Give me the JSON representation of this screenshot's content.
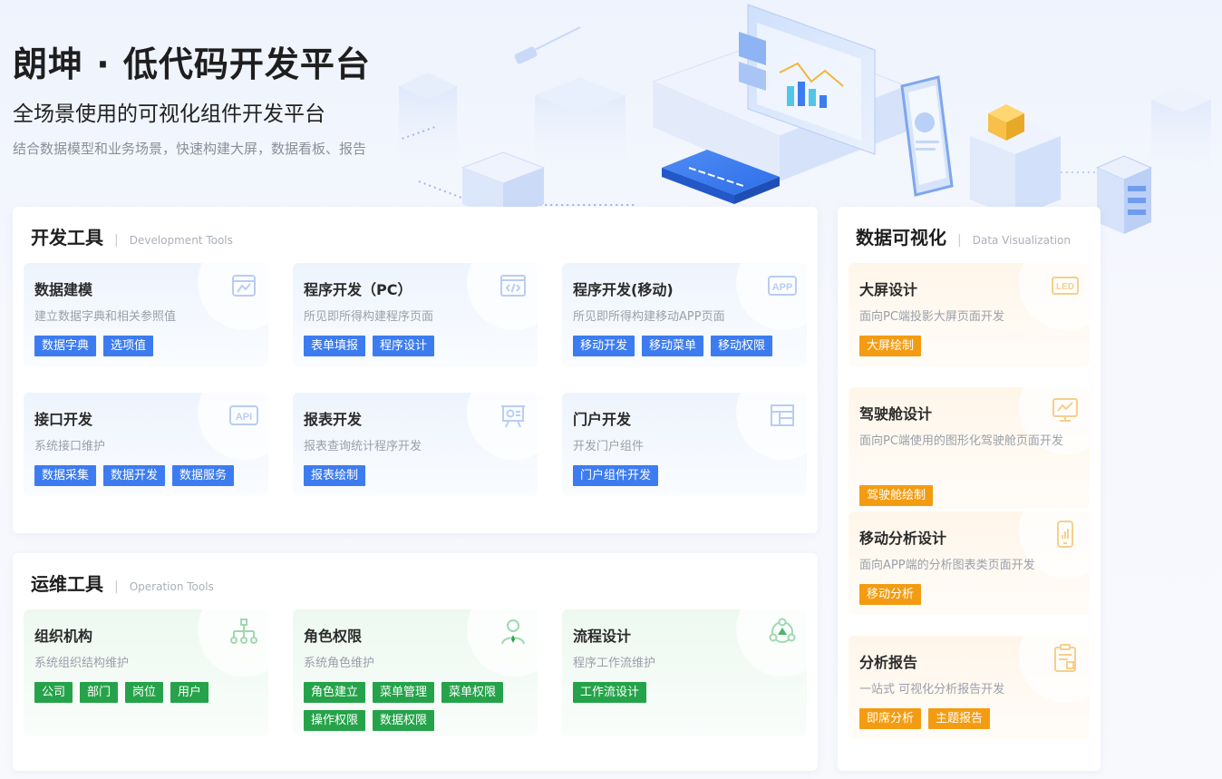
{
  "hero": {
    "title": "朗坤 · 低代码开发平台",
    "subtitle": "全场景使用的可视化组件开发平台",
    "description": "结合数据模型和业务场景，快速构建大屏，数据看板、报告"
  },
  "dev_tools": {
    "title": "开发工具",
    "title_en": "Development Tools",
    "cards": [
      {
        "title": "数据建模",
        "desc": "建立数据字典和相关参照值",
        "icon": "data-model-icon",
        "tags": [
          "数据字典",
          "选项值"
        ]
      },
      {
        "title": "程序开发（PC）",
        "desc": "所见即所得构建程序页面",
        "icon": "code-window-icon",
        "tags": [
          "表单填报",
          "程序设计"
        ]
      },
      {
        "title": "程序开发(移动)",
        "desc": "所见即所得构建移动APP页面",
        "icon": "app-icon",
        "icon_text": "APP",
        "tags": [
          "移动开发",
          "移动菜单",
          "移动权限"
        ]
      },
      {
        "title": "接口开发",
        "desc": "系统接口维护",
        "icon": "api-icon",
        "icon_text": "API",
        "tags": [
          "数据采集",
          "数据开发",
          "数据服务"
        ]
      },
      {
        "title": "报表开发",
        "desc": "报表查询统计程序开发",
        "icon": "presentation-chart-icon",
        "tags": [
          "报表绘制"
        ]
      },
      {
        "title": "门户开发",
        "desc": "开发门户组件",
        "icon": "portal-layout-icon",
        "tags": [
          "门户组件开发"
        ]
      }
    ]
  },
  "ops_tools": {
    "title": "运维工具",
    "title_en": "Operation Tools",
    "cards": [
      {
        "title": "组织机构",
        "desc": "系统组织结构维护",
        "icon": "org-tree-icon",
        "tags": [
          "公司",
          "部门",
          "岗位",
          "用户"
        ]
      },
      {
        "title": "角色权限",
        "desc": "系统角色维护",
        "icon": "user-role-icon",
        "tags": [
          "角色建立",
          "菜单管理",
          "菜单权限",
          "操作权限",
          "数据权限"
        ]
      },
      {
        "title": "流程设计",
        "desc": "程序工作流维护",
        "icon": "workflow-icon",
        "tags": [
          "工作流设计"
        ]
      }
    ]
  },
  "data_vis": {
    "title": "数据可视化",
    "title_en": "Data Visualization",
    "cards": [
      {
        "title": "大屏设计",
        "desc": "面向PC端投影大屏页面开发",
        "icon": "led-screen-icon",
        "icon_text": "LED",
        "tags": [
          "大屏绘制"
        ]
      },
      {
        "title": "驾驶舱设计",
        "desc": "面向PC端使用的图形化驾驶舱页面开发",
        "icon": "dashboard-monitor-icon",
        "tags": [
          "驾驶舱绘制"
        ]
      },
      {
        "title": "移动分析设计",
        "desc": "面向APP端的分析图表类页面开发",
        "icon": "mobile-chart-icon",
        "tags": [
          "移动分析"
        ]
      },
      {
        "title": "分析报告",
        "desc": "一站式 可视化分析报告开发",
        "icon": "report-clipboard-icon",
        "tags": [
          "即席分析",
          "主题报告"
        ]
      }
    ]
  },
  "colors": {
    "blue_tag": "#3d7cf0",
    "green_tag": "#26a34a",
    "orange_tag": "#f39c12"
  }
}
